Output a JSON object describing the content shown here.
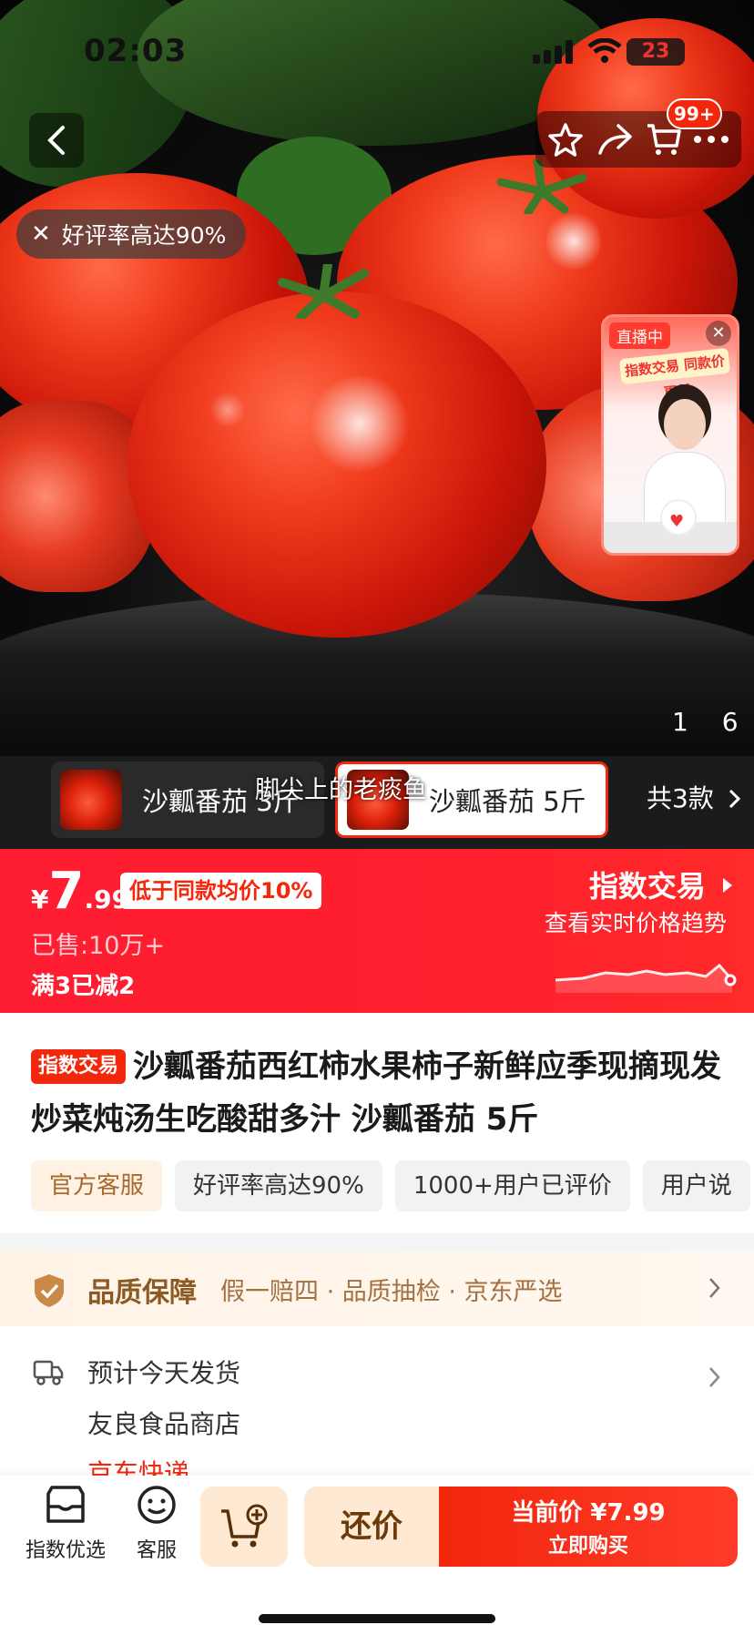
{
  "status_bar": {
    "time": "02:03",
    "battery": "23"
  },
  "nav": {
    "cart_badge": "99+"
  },
  "hero": {
    "rating_pill": "好评率高达90%",
    "pager": "1 6"
  },
  "live": {
    "tag": "直播中",
    "banner": "指数交易 同款价更低"
  },
  "variants": {
    "overlay_text": "脚尖上的老痰鱼",
    "items": [
      {
        "label": "沙瓤番茄 3斤"
      },
      {
        "label": "沙瓤番茄 5斤"
      }
    ],
    "count": "共3款"
  },
  "price": {
    "currency": "¥",
    "integer": "7",
    "decimal": ".99",
    "below_tag": "低于同款均价10%",
    "sold": "已售:10万+",
    "promo": "满3已减2",
    "index_title": "指数交易",
    "index_sub": "查看实时价格趋势"
  },
  "product": {
    "tag": "指数交易",
    "title": "沙瓤番茄西红柿水果柿子新鲜应季现摘现发 炒菜炖汤生吃酸甜多汁 沙瓤番茄 5斤",
    "chips": [
      "官方客服",
      "好评率高达90%",
      "1000+用户已评价",
      "用户说"
    ]
  },
  "quality": {
    "title": "品质保障",
    "subtitle": "假一赔四 · 品质抽检 · 京东严选"
  },
  "shipping": {
    "line1": "预计今天发货",
    "line2": "友良食品商店",
    "line3": "京东快递"
  },
  "bottom_bar": {
    "store_label": "指数优选",
    "service_label": "客服",
    "bargain_label": "还价",
    "buy_price": "当前价 ¥7.99",
    "buy_label": "立即购买"
  },
  "colors": {
    "accent": "#f2270c",
    "price_band": "#ff1d32",
    "gold": "#a86a2c"
  }
}
